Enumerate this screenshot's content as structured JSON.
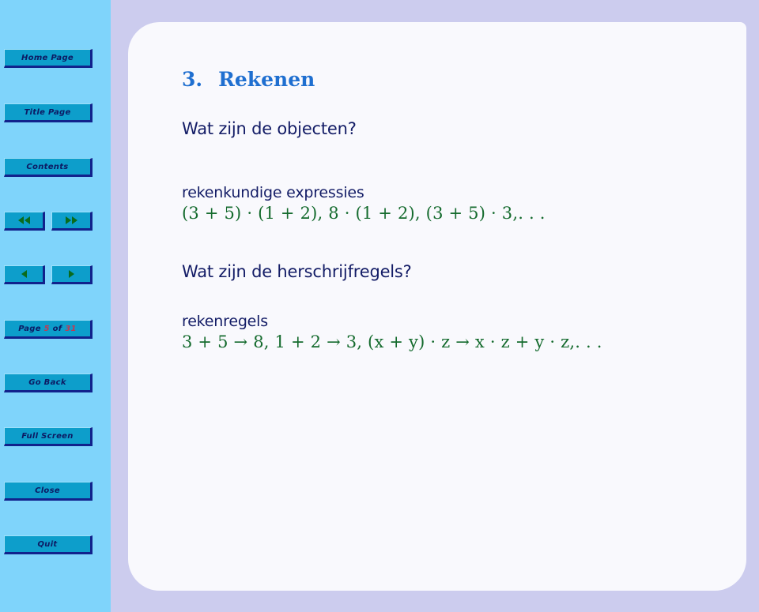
{
  "theme": {
    "sidebar_bg": "#7fd4fb",
    "page_bg": "#ccccee",
    "slide_bg": "#f9f9fd",
    "button_bg": "#0d9ecb",
    "button_shadow": "#11228c",
    "button_text": "#0d1a63",
    "heading_blue": "#1f6fd0",
    "body_navy": "#131c66",
    "math_green": "#156b2e",
    "arrow_green": "#0a6b1c",
    "pagenum_red": "#c23a52"
  },
  "sidebar": {
    "buttons": [
      {
        "id": "home-page",
        "label": "Home Page"
      },
      {
        "id": "title-page",
        "label": "Title Page"
      },
      {
        "id": "contents",
        "label": "Contents"
      },
      {
        "id": "go-back",
        "label": "Go Back"
      },
      {
        "id": "full-screen",
        "label": "Full Screen"
      },
      {
        "id": "close",
        "label": "Close"
      },
      {
        "id": "quit",
        "label": "Quit"
      }
    ],
    "nav": {
      "first_icon": "double-arrow-left-icon",
      "last_icon": "double-arrow-right-icon",
      "prev_icon": "arrow-left-icon",
      "next_icon": "arrow-right-icon"
    },
    "page_indicator": {
      "prefix": "Page ",
      "current": "5",
      "middle": " of ",
      "total": "31"
    }
  },
  "slide": {
    "section_number": "3.",
    "section_title": "Rekenen",
    "blocks": [
      {
        "type": "question",
        "text": "Wat zijn de objecten?"
      },
      {
        "type": "label",
        "text": "rekenkundige expressies"
      },
      {
        "type": "math",
        "text": "(3 + 5) · (1 + 2), 8 · (1 + 2), (3 + 5) · 3,. . ."
      },
      {
        "type": "question",
        "text": "Wat zijn de herschrijfregels?"
      },
      {
        "type": "label",
        "text": "rekenregels"
      },
      {
        "type": "math",
        "text": "3 + 5 → 8, 1 + 2 → 3, (x + y) · z → x · z + y · z,. . ."
      }
    ]
  }
}
